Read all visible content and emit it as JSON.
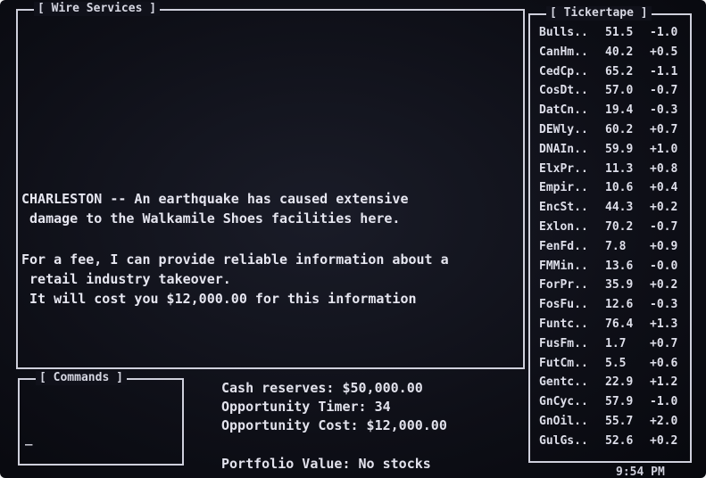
{
  "wire": {
    "title": "[ Wire Services ]",
    "message1_line1": "CHARLESTON -- An earthquake has caused extensive",
    "message1_line2": " damage to the Walkamile Shoes facilities here.",
    "message2_line1": "For a fee, I can provide reliable information about a",
    "message2_line2": " retail industry takeover.",
    "message2_line3": " It will cost you $12,000.00 for this information"
  },
  "ticker": {
    "title": "[ Tickertape ]",
    "rows": [
      {
        "name": "Bulls..",
        "price": "51.5",
        "change": "-1.0"
      },
      {
        "name": "CanHm..",
        "price": "40.2",
        "change": "+0.5"
      },
      {
        "name": "CedCp..",
        "price": "65.2",
        "change": "-1.1"
      },
      {
        "name": "CosDt..",
        "price": "57.0",
        "change": "-0.7"
      },
      {
        "name": "DatCn..",
        "price": "19.4",
        "change": "-0.3"
      },
      {
        "name": "DEWly..",
        "price": "60.2",
        "change": "+0.7"
      },
      {
        "name": "DNAIn..",
        "price": "59.9",
        "change": "+1.0"
      },
      {
        "name": "ElxPr..",
        "price": "11.3",
        "change": "+0.8"
      },
      {
        "name": "Empir..",
        "price": "10.6",
        "change": "+0.4"
      },
      {
        "name": "EncSt..",
        "price": "44.3",
        "change": "+0.2"
      },
      {
        "name": "Exlon..",
        "price": "70.2",
        "change": "-0.7"
      },
      {
        "name": "FenFd..",
        "price": "7.8",
        "change": "+0.9"
      },
      {
        "name": "FMMin..",
        "price": "13.6",
        "change": "-0.0"
      },
      {
        "name": "ForPr..",
        "price": "35.9",
        "change": "+0.2"
      },
      {
        "name": "FosFu..",
        "price": "12.6",
        "change": "-0.3"
      },
      {
        "name": "Funtc..",
        "price": "76.4",
        "change": "+1.3"
      },
      {
        "name": "FusFm..",
        "price": "1.7",
        "change": "+0.7"
      },
      {
        "name": "FutCm..",
        "price": "5.5",
        "change": "+0.6"
      },
      {
        "name": "Gentc..",
        "price": "22.9",
        "change": "+1.2"
      },
      {
        "name": "GnCyc..",
        "price": "57.9",
        "change": "-1.0"
      },
      {
        "name": "GnOil..",
        "price": "55.7",
        "change": "+2.0"
      },
      {
        "name": "GulGs..",
        "price": "52.6",
        "change": "+0.2"
      }
    ]
  },
  "commands": {
    "title": "[ Commands ]",
    "prompt": "_"
  },
  "status": {
    "cash": "Cash reserves: $50,000.00",
    "timer": "Opportunity Timer: 34",
    "cost": "Opportunity Cost: $12,000.00",
    "portfolio": "Portfolio Value: No stocks"
  },
  "clock": "9:54 PM"
}
